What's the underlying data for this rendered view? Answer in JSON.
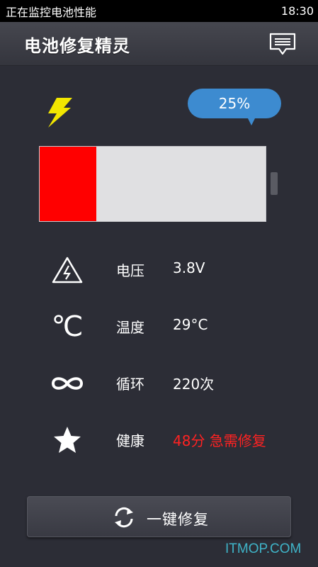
{
  "status_bar": {
    "notification": "正在监控电池性能",
    "time": "18:30"
  },
  "header": {
    "title": "电池修复精灵",
    "message_icon": "message-icon"
  },
  "battery": {
    "percent_label": "25%",
    "level_fraction": 0.25,
    "fill_color": "#ff0000",
    "bubble_color": "#3d8bd0",
    "charge_icon": "lightning-bolt-icon"
  },
  "stats": [
    {
      "icon": "high-voltage-icon",
      "label": "电压",
      "value": "3.8V",
      "alert": false
    },
    {
      "icon": "celsius-icon",
      "label": "温度",
      "value": "29°C",
      "alert": false
    },
    {
      "icon": "infinity-icon",
      "label": "循环",
      "value": "220次",
      "alert": false
    },
    {
      "icon": "star-icon",
      "label": "健康",
      "value": "48分 急需修复",
      "alert": true
    }
  ],
  "actions": {
    "repair_label": "一键修复",
    "repair_icon": "refresh-icon"
  },
  "colors": {
    "background": "#2c2d36",
    "alert": "#ff2222",
    "watermark": "#3fb4c8"
  },
  "watermark": "ITMOP.COM"
}
